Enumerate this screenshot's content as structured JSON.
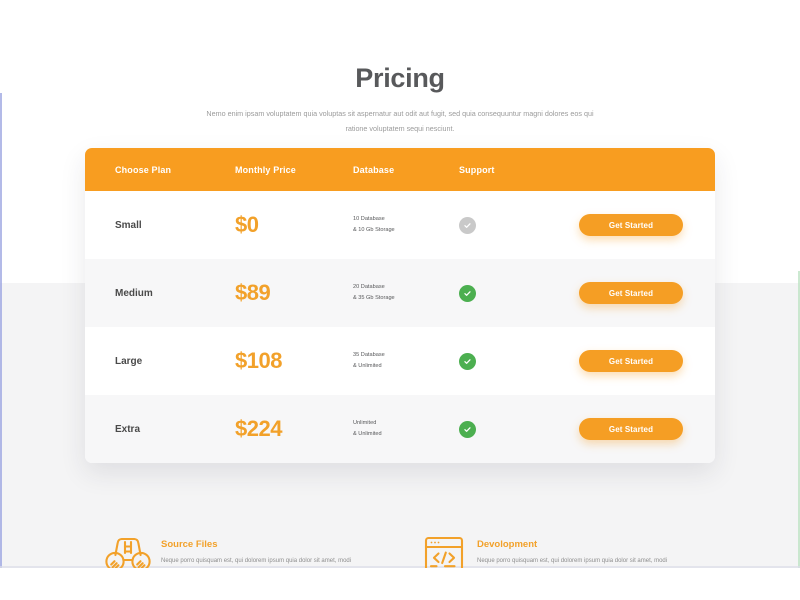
{
  "header": {
    "title": "Pricing",
    "subtitle": "Nemo enim ipsam voluptatem quia voluptas sit aspernatur aut odit aut fugit, sed quia consequuntur magni dolores eos qui ratione voluptatem sequi nesciunt."
  },
  "theme": {
    "accent_orange": "#f89d20",
    "price_orange": "#f2a12a",
    "button_orange": "#f59e24",
    "check_green": "#4caf50",
    "check_gray": "#c9c9c9",
    "title_gray": "#58595b",
    "row_alt_bg": "#f7f7f8",
    "page_band_bg": "#f4f4f5"
  },
  "pricing_table": {
    "columns": [
      {
        "key": "plan",
        "label": "Choose Plan"
      },
      {
        "key": "price",
        "label": "Monthly Price"
      },
      {
        "key": "database",
        "label": "Database"
      },
      {
        "key": "support",
        "label": "Support"
      },
      {
        "key": "action",
        "label": ""
      }
    ],
    "rows": [
      {
        "plan": "Small",
        "price": "$0",
        "database_line1": "10 Database",
        "database_line2": "& 10 Gb Storage",
        "support_state": "inactive",
        "support_icon": "check-circle-icon",
        "button_label": "Get Started"
      },
      {
        "plan": "Medium",
        "price": "$89",
        "database_line1": "20 Database",
        "database_line2": "& 35 Gb Storage",
        "support_state": "active",
        "support_icon": "check-circle-icon",
        "button_label": "Get Started"
      },
      {
        "plan": "Large",
        "price": "$108",
        "database_line1": "35 Database",
        "database_line2": "& Unlimited",
        "support_state": "active",
        "support_icon": "check-circle-icon",
        "button_label": "Get Started"
      },
      {
        "plan": "Extra",
        "price": "$224",
        "database_line1": "Unlimited",
        "database_line2": "& Unlimited",
        "support_state": "active",
        "support_icon": "check-circle-icon",
        "button_label": "Get Started"
      }
    ]
  },
  "features": [
    {
      "icon": "binoculars-icon",
      "title": "Source Files",
      "text": "Neque porro quisquam est, qui dolorem ipsum quia dolor sit amet, modi tempora incidunt  quaerat voluptatem."
    },
    {
      "icon": "code-browser-icon",
      "title": "Devolopment",
      "text": "Neque porro quisquam est, qui dolorem ipsum quia dolor sit amet, modi tempora incidunt  quaerat voluptatem."
    }
  ]
}
